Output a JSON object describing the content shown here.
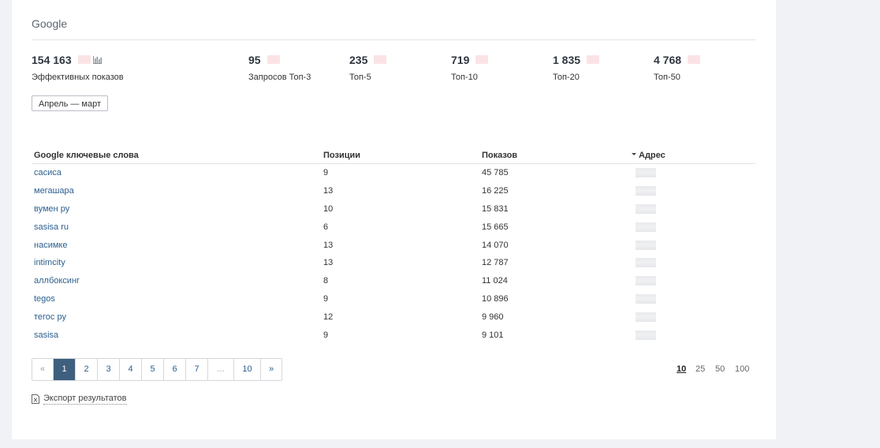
{
  "section_title": "Google",
  "stats": [
    {
      "value": "154 163",
      "label": "Эффективных показов",
      "icon": "bar-chart-icon"
    },
    {
      "value": "95",
      "label": "Запросов Топ-3"
    },
    {
      "value": "235",
      "label": "Топ-5"
    },
    {
      "value": "719",
      "label": "Топ-10"
    },
    {
      "value": "1 835",
      "label": "Топ-20"
    },
    {
      "value": "4 768",
      "label": "Топ-50"
    }
  ],
  "period_button": "Апрель — март",
  "table": {
    "headers": {
      "keyword": "Google ключевые слова",
      "positions": "Позиции",
      "impressions": "Показов",
      "address": "Адрес"
    },
    "sort_column": "address",
    "rows": [
      {
        "keyword": "сасиса",
        "position": "9",
        "impressions": "45 785"
      },
      {
        "keyword": "мегашара",
        "position": "13",
        "impressions": "16 225"
      },
      {
        "keyword": "вумен ру",
        "position": "10",
        "impressions": "15 831"
      },
      {
        "keyword": "sasisa ru",
        "position": "6",
        "impressions": "15 665"
      },
      {
        "keyword": "насимке",
        "position": "13",
        "impressions": "14 070"
      },
      {
        "keyword": "intimcity",
        "position": "13",
        "impressions": "12 787"
      },
      {
        "keyword": "аллбоксинг",
        "position": "8",
        "impressions": "11 024"
      },
      {
        "keyword": "tegos",
        "position": "9",
        "impressions": "10 896"
      },
      {
        "keyword": "тегос ру",
        "position": "12",
        "impressions": "9 960"
      },
      {
        "keyword": "sasisa",
        "position": "9",
        "impressions": "9 101"
      }
    ]
  },
  "pagination": {
    "prev": "«",
    "pages": [
      "1",
      "2",
      "3",
      "4",
      "5",
      "6",
      "7"
    ],
    "ellipsis": "...",
    "last": "10",
    "next": "»",
    "current": "1"
  },
  "page_sizes": [
    "10",
    "25",
    "50",
    "100"
  ],
  "page_size_current": "10",
  "export_label": "Экспорт результатов",
  "colors": {
    "accent": "#3e5f7e",
    "link": "#2b5f8f",
    "redacted": "#fbe3e5",
    "background": "#f1f2f6"
  }
}
